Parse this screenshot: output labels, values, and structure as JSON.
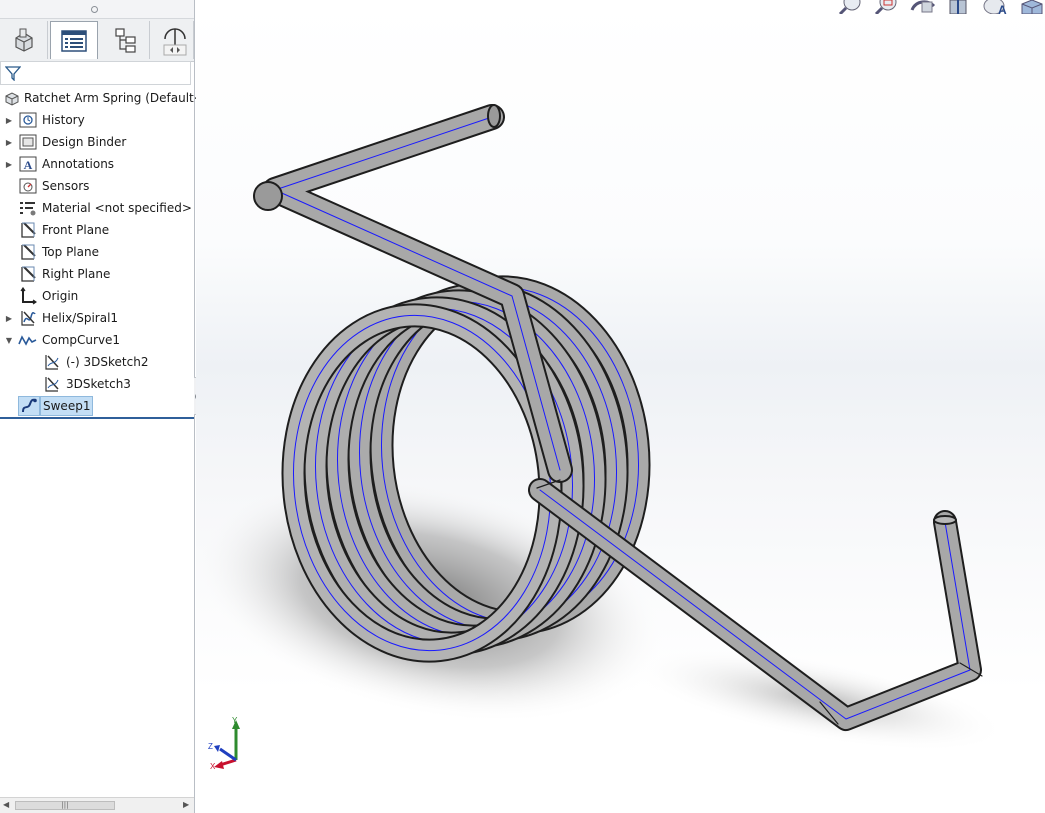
{
  "feature_manager": {
    "tabs": [
      {
        "icon": "feature-manager-tree-icon",
        "active": false
      },
      {
        "icon": "property-manager-icon",
        "active": true
      },
      {
        "icon": "configuration-manager-icon",
        "active": false
      },
      {
        "icon": "dimxpert-manager-icon",
        "active": false
      }
    ],
    "filter_icon": "funnel-filter-icon",
    "root_label": "Ratchet Arm Spring  (Default<<D",
    "items": [
      {
        "label": "History",
        "icon": "history-folder-icon",
        "expandable": true,
        "expanded": false
      },
      {
        "label": "Design Binder",
        "icon": "design-binder-icon",
        "expandable": true,
        "expanded": false
      },
      {
        "label": "Annotations",
        "icon": "annotations-icon",
        "expandable": true,
        "expanded": false
      },
      {
        "label": "Sensors",
        "icon": "sensors-icon",
        "expandable": false
      },
      {
        "label": "Material <not specified>",
        "icon": "material-icon",
        "expandable": false
      },
      {
        "label": "Front Plane",
        "icon": "plane-icon",
        "expandable": false
      },
      {
        "label": "Top Plane",
        "icon": "plane-icon",
        "expandable": false
      },
      {
        "label": "Right Plane",
        "icon": "plane-icon",
        "expandable": false
      },
      {
        "label": "Origin",
        "icon": "origin-icon",
        "expandable": false
      },
      {
        "label": "Helix/Spiral1",
        "icon": "helix-icon",
        "expandable": true,
        "expanded": false
      },
      {
        "label": "CompCurve1",
        "icon": "composite-curve-icon",
        "expandable": true,
        "expanded": true
      },
      {
        "label": "(-) 3DSketch2",
        "icon": "sketch3d-icon",
        "child": true
      },
      {
        "label": "3DSketch3",
        "icon": "sketch3d-icon",
        "child": true
      },
      {
        "label": "Sweep1",
        "icon": "sweep-icon",
        "selected": true
      }
    ]
  },
  "view_toolbar": {
    "buttons": [
      "zoom-to-fit-icon",
      "zoom-to-area-icon",
      "previous-view-icon",
      "section-view-icon",
      "view-orientation-icon",
      "display-style-icon"
    ]
  },
  "triad": {
    "axes": [
      "X",
      "Y",
      "Z"
    ]
  },
  "colors": {
    "selection": "#c3def5",
    "model_gray": "#a8a8a8",
    "edge_blue": "#1a1aff",
    "triad_x": "#c8102e",
    "triad_y": "#2e8b2e",
    "triad_z": "#1f3fbf"
  }
}
